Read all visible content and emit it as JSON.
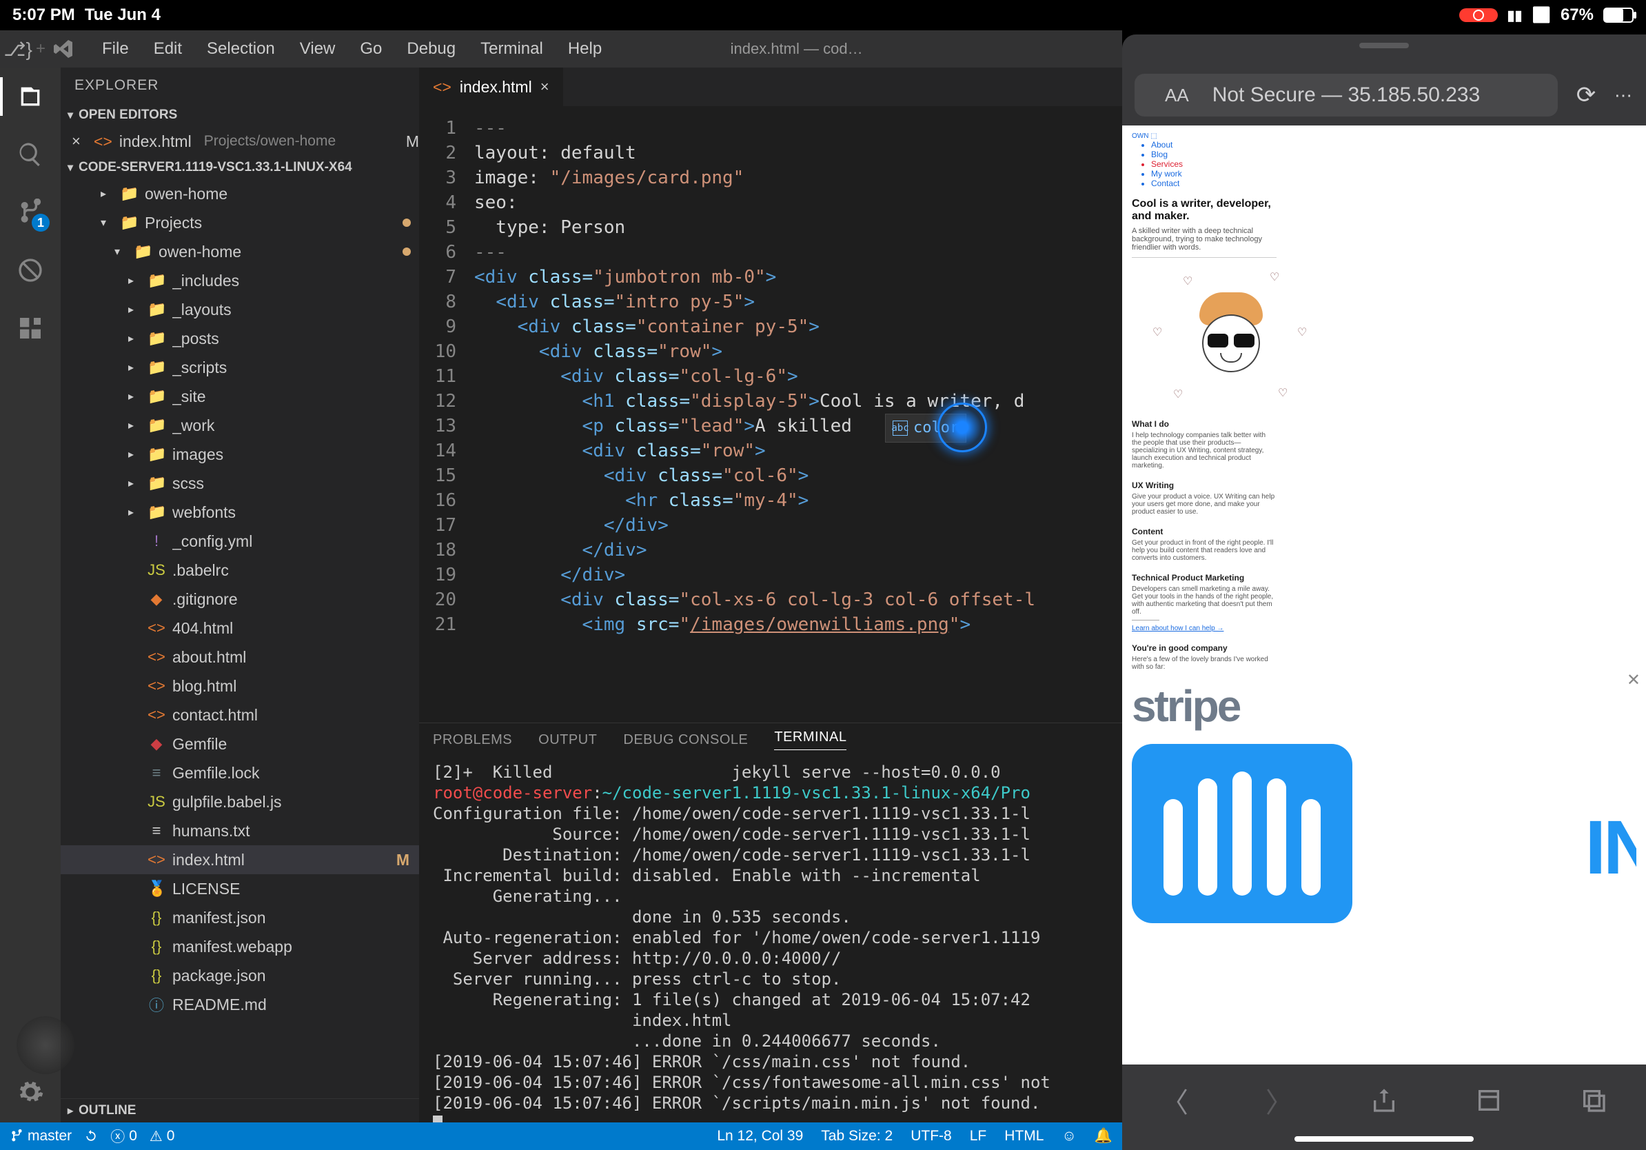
{
  "status": {
    "time": "5:07 PM",
    "date": "Tue Jun 4",
    "battery_pct": "67%"
  },
  "menubar": {
    "items": [
      "File",
      "Edit",
      "Selection",
      "View",
      "Go",
      "Debug",
      "Terminal",
      "Help"
    ],
    "title": "index.html — cod…"
  },
  "activity": {
    "scm_badge": "1"
  },
  "explorer": {
    "title": "EXPLORER",
    "open_editors_label": "OPEN EDITORS",
    "open_editor": {
      "name": "index.html",
      "path": "Projects/owen-home",
      "mod": "M"
    },
    "workspace_label": "CODE-SERVER1.1119-VSC1.33.1-LINUX-X64",
    "tree": [
      {
        "tw": "▸",
        "ind": 1,
        "icon": "folder",
        "label": "owen-home"
      },
      {
        "tw": "▾",
        "ind": 1,
        "icon": "folder",
        "label": "Projects",
        "dot": true
      },
      {
        "tw": "▾",
        "ind": 2,
        "icon": "folder",
        "label": "owen-home",
        "dot": true
      },
      {
        "tw": "▸",
        "ind": 3,
        "icon": "folder",
        "label": "_includes"
      },
      {
        "tw": "▸",
        "ind": 3,
        "icon": "folder",
        "label": "_layouts"
      },
      {
        "tw": "▸",
        "ind": 3,
        "icon": "folder",
        "label": "_posts"
      },
      {
        "tw": "▸",
        "ind": 3,
        "icon": "folder",
        "label": "_scripts"
      },
      {
        "tw": "▸",
        "ind": 3,
        "icon": "folder",
        "label": "_site"
      },
      {
        "tw": "▸",
        "ind": 3,
        "icon": "folder",
        "label": "_work"
      },
      {
        "tw": "▸",
        "ind": 3,
        "icon": "folder",
        "label": "images"
      },
      {
        "tw": "▸",
        "ind": 3,
        "icon": "folder",
        "label": "scss"
      },
      {
        "tw": "▸",
        "ind": 3,
        "icon": "folder",
        "label": "webfonts"
      },
      {
        "tw": "",
        "ind": 3,
        "icon": "yml",
        "label": "_config.yml"
      },
      {
        "tw": "",
        "ind": 3,
        "icon": "js",
        "label": ".babelrc"
      },
      {
        "tw": "",
        "ind": 3,
        "icon": "git",
        "label": ".gitignore"
      },
      {
        "tw": "",
        "ind": 3,
        "icon": "html",
        "label": "404.html"
      },
      {
        "tw": "",
        "ind": 3,
        "icon": "html",
        "label": "about.html"
      },
      {
        "tw": "",
        "ind": 3,
        "icon": "html",
        "label": "blog.html"
      },
      {
        "tw": "",
        "ind": 3,
        "icon": "html",
        "label": "contact.html"
      },
      {
        "tw": "",
        "ind": 3,
        "icon": "gem",
        "label": "Gemfile"
      },
      {
        "tw": "",
        "ind": 3,
        "icon": "lock",
        "label": "Gemfile.lock"
      },
      {
        "tw": "",
        "ind": 3,
        "icon": "js",
        "label": "gulpfile.babel.js"
      },
      {
        "tw": "",
        "ind": 3,
        "icon": "txt",
        "label": "humans.txt"
      },
      {
        "tw": "",
        "ind": 3,
        "icon": "html",
        "label": "index.html",
        "sel": true,
        "mod": "M"
      },
      {
        "tw": "",
        "ind": 3,
        "icon": "cert",
        "label": "LICENSE"
      },
      {
        "tw": "",
        "ind": 3,
        "icon": "json",
        "label": "manifest.json"
      },
      {
        "tw": "",
        "ind": 3,
        "icon": "json",
        "label": "manifest.webapp"
      },
      {
        "tw": "",
        "ind": 3,
        "icon": "json",
        "label": "package.json"
      },
      {
        "tw": "",
        "ind": 3,
        "icon": "md",
        "label": "README.md"
      }
    ],
    "outline_label": "OUTLINE"
  },
  "editor": {
    "tab_name": "index.html",
    "line_numbers": [
      "1",
      "2",
      "3",
      "4",
      "5",
      "6",
      "7",
      "8",
      "9",
      "10",
      "11",
      "12",
      "13",
      "14",
      "15",
      "16",
      "17",
      "18",
      "19",
      "20",
      "21"
    ],
    "lines_html": [
      "<span class='tok-punc'>---</span>",
      "<span class='tok-text'>layout: default</span>",
      "<span class='tok-text'>image: </span><span class='tok-str'>\"/images/card.png\"</span>",
      "<span class='tok-text'>seo:</span>",
      "<span class='tok-text'>  type: Person</span>",
      "<span class='tok-punc'>---</span>",
      "<span class='tok-tag'>&lt;div</span> <span class='tok-attr'>class=</span><span class='tok-str'>\"jumbotron mb-0\"</span><span class='tok-tag'>&gt;</span>",
      "  <span class='tok-tag'>&lt;div</span> <span class='tok-attr'>class=</span><span class='tok-str'>\"intro py-5\"</span><span class='tok-tag'>&gt;</span>",
      "    <span class='tok-tag'>&lt;div</span> <span class='tok-attr'>class=</span><span class='tok-str'>\"container py-5\"</span><span class='tok-tag'>&gt;</span>",
      "      <span class='tok-tag'>&lt;div</span> <span class='tok-attr'>class=</span><span class='tok-str'>\"row\"</span><span class='tok-tag'>&gt;</span>",
      "        <span class='tok-tag'>&lt;div</span> <span class='tok-attr'>class=</span><span class='tok-str'>\"col-lg-6\"</span><span class='tok-tag'>&gt;</span>",
      "          <span class='tok-tag'>&lt;h1</span> <span class='tok-attr'>class=</span><span class='tok-str'>\"display-5\"</span><span class='tok-tag'>&gt;</span><span class='tok-text'>Cool is a writer, d</span>",
      "          <span class='tok-tag'>&lt;p</span> <span class='tok-attr'>class=</span><span class='tok-str'>\"lead\"</span><span class='tok-tag'>&gt;</span><span class='tok-text'>A skilled </span>",
      "          <span class='tok-tag'>&lt;div</span> <span class='tok-attr'>class=</span><span class='tok-str'>\"row\"</span><span class='tok-tag'>&gt;</span>",
      "            <span class='tok-tag'>&lt;div</span> <span class='tok-attr'>class=</span><span class='tok-str'>\"col-6\"</span><span class='tok-tag'>&gt;</span>",
      "              <span class='tok-tag'>&lt;hr</span> <span class='tok-attr'>class=</span><span class='tok-str'>\"my-4\"</span><span class='tok-tag'>&gt;</span>",
      "            <span class='tok-tag'>&lt;/div&gt;</span>",
      "          <span class='tok-tag'>&lt;/div&gt;</span>",
      "        <span class='tok-tag'>&lt;/div&gt;</span>",
      "        <span class='tok-tag'>&lt;div</span> <span class='tok-attr'>class=</span><span class='tok-str'>\"col-xs-6 col-lg-3 col-6 offset-l</span>",
      "          <span class='tok-tag'>&lt;img</span> <span class='tok-attr'>src=</span><span class='tok-str'>\"<u>/images/owenwilliams.png</u>\"</span><span class='tok-tag'>&gt;</span>"
    ],
    "suggest": {
      "icon_label": "abc",
      "text": "color"
    }
  },
  "panel": {
    "tabs": {
      "problems": "PROBLEMS",
      "output": "OUTPUT",
      "debug": "DEBUG CONSOLE",
      "terminal": "TERMINAL"
    },
    "terminal_lines": [
      {
        "plain": "[2]+  Killed                  jekyll serve --host=0.0.0.0"
      },
      {
        "html": "<span class='term-red'>root@code-server</span>:<span class='term-cyan'>~/code-server1.1119-vsc1.33.1-linux-x64/Pro</span>"
      },
      {
        "plain": "Configuration file: /home/owen/code-server1.1119-vsc1.33.1-l"
      },
      {
        "plain": "            Source: /home/owen/code-server1.1119-vsc1.33.1-l"
      },
      {
        "plain": "       Destination: /home/owen/code-server1.1119-vsc1.33.1-l"
      },
      {
        "plain": " Incremental build: disabled. Enable with --incremental"
      },
      {
        "plain": "      Generating..."
      },
      {
        "plain": "                    done in 0.535 seconds."
      },
      {
        "plain": " Auto-regeneration: enabled for '/home/owen/code-server1.1119"
      },
      {
        "plain": "    Server address: http://0.0.0.0:4000//"
      },
      {
        "plain": "  Server running... press ctrl-c to stop."
      },
      {
        "plain": "      Regenerating: 1 file(s) changed at 2019-06-04 15:07:42"
      },
      {
        "plain": "                    index.html"
      },
      {
        "plain": "                    ...done in 0.244006677 seconds."
      },
      {
        "plain": ""
      },
      {
        "plain": "[2019-06-04 15:07:46] ERROR `/css/main.css' not found."
      },
      {
        "plain": "[2019-06-04 15:07:46] ERROR `/css/fontawesome-all.min.css' not"
      },
      {
        "plain": "[2019-06-04 15:07:46] ERROR `/scripts/main.min.js' not found."
      }
    ]
  },
  "statusbar": {
    "branch": "master",
    "errors": "0",
    "warnings": "0",
    "ln_col": "Ln 12, Col 39",
    "spaces": "Tab Size: 2",
    "encoding": "UTF-8",
    "eol": "LF",
    "lang": "HTML"
  },
  "safari": {
    "addr_prefix": "Not Secure — ",
    "addr_host": "35.185.50.233",
    "nav": [
      "About",
      "Blog",
      "Services",
      "My work",
      "Contact"
    ],
    "hero_title": "Cool is a writer, developer, and maker.",
    "hero_sub": "A skilled writer with a deep technical background, trying to make technology friendlier with words.",
    "what_h": "What I do",
    "what_p": "I help technology companies talk better with the people that use their products—specializing in UX Writing, content strategy, launch execution and technical product marketing.",
    "ux_h": "UX Writing",
    "ux_p": "Give your product a voice. UX Writing can help your users get more done, and make your product easier to use.",
    "content_h": "Content",
    "content_p": "Get your product in front of the right people. I'll help you build content that readers love and converts into customers.",
    "tpm_h": "Technical Product Marketing",
    "tpm_p": "Developers can smell marketing a mile away. Get your tools in the hands of the right people, with authentic marketing that doesn't put them off.",
    "cta": "Learn about how I can help →",
    "company_h": "You're in good company",
    "company_p": "Here's a few of the lovely brands I've worked with so far:",
    "stripe": "stripe",
    "inte": "INTE"
  }
}
